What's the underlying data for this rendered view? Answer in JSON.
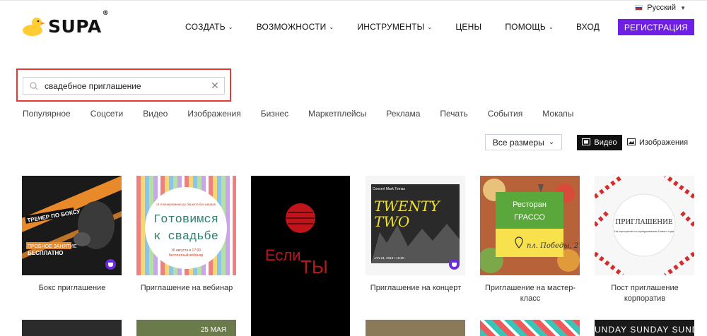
{
  "header": {
    "logo_text": "SUPA",
    "logo_reg": "®",
    "language": "Русский",
    "nav": [
      {
        "label": "СОЗДАТЬ",
        "dropdown": true
      },
      {
        "label": "ВОЗМОЖНОСТИ",
        "dropdown": true
      },
      {
        "label": "ИНСТРУМЕНТЫ",
        "dropdown": true
      },
      {
        "label": "ЦЕНЫ",
        "dropdown": false
      },
      {
        "label": "ПОМОЩЬ",
        "dropdown": true
      }
    ],
    "login": "ВХОД",
    "register": "РЕГИСТРАЦИЯ",
    "accent": "#6f1ee6"
  },
  "search": {
    "value": "свадебное приглашение",
    "highlight_color": "#e53935"
  },
  "categories": [
    "Популярное",
    "Соцсети",
    "Видео",
    "Изображения",
    "Бизнес",
    "Маркетплейсы",
    "Реклама",
    "Печать",
    "События",
    "Мокапы"
  ],
  "filters": {
    "sizes": "Все размеры",
    "video": "Видео",
    "images": "Изображения"
  },
  "cards": [
    {
      "title": "Бокс приглашение",
      "art": {
        "l1": "ТРЕНЕР ПО БОКСУ",
        "l2": "ПРОБНОЕ ЗАНЯТИЕ",
        "l3": "БЕСПЛАТНО"
      },
      "premium": true
    },
    {
      "title": "Приглашение на вебинар",
      "art": {
        "top": "от планирования до банкета без нервов",
        "l1": "Готовимся",
        "l2": "к свадьбе",
        "bottom": "16 августа в 17:00",
        "bottom2": "бесплатный вебинар"
      },
      "premium": false
    },
    {
      "title": "",
      "art": {
        "w1": "Если",
        "w2": "ТЫ"
      },
      "premium": false
    },
    {
      "title": "Приглашение на концерт",
      "art": {
        "top": "Concert Mark Tomas",
        "l1": "TWENTY",
        "l2": "TWO",
        "date": "JAN 21, 2019 • 16:00"
      },
      "premium": true
    },
    {
      "title": "Приглашение на мастер-класс",
      "art": {
        "l1": "Ресторан",
        "l2": "ГРАССО",
        "l3": "пл. Победы, 27"
      },
      "premium": false
    },
    {
      "title": "Пост приглашение корпоратив",
      "art": {
        "l1": "ПРИГЛАШЕНИЕ",
        "l2": "На корпоратив по празднованию Нового года"
      },
      "premium": false
    }
  ],
  "bottom_row": {
    "t2": "25 МАЯ",
    "t6": "UNDAY SUNDAY SUNDAY S"
  }
}
